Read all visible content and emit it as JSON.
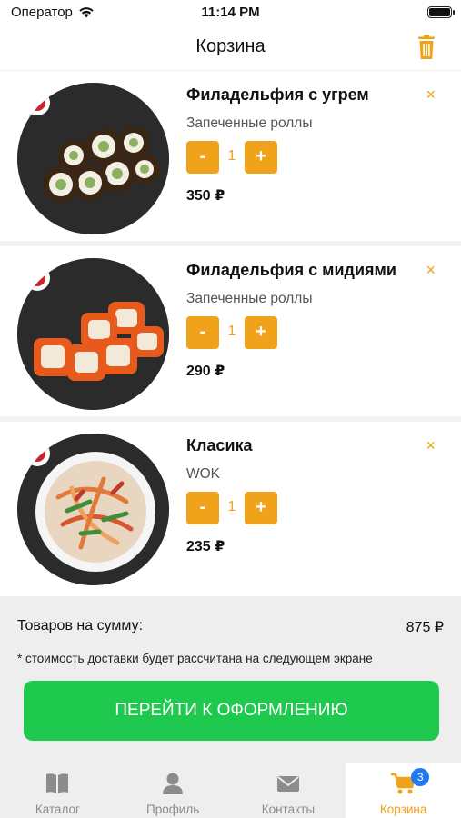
{
  "status_bar": {
    "carrier": "Оператор",
    "time": "11:14 PM"
  },
  "nav": {
    "title": "Корзина"
  },
  "cart": {
    "items": [
      {
        "name": "Филадельфия с угрем",
        "category": "Запеченные роллы",
        "quantity": "1",
        "price": "350 ₽",
        "minus": "-",
        "plus": "+",
        "remove": "×"
      },
      {
        "name": "Филадельфия с мидиями",
        "category": "Запеченные роллы",
        "quantity": "1",
        "price": "290 ₽",
        "minus": "-",
        "plus": "+",
        "remove": "×"
      },
      {
        "name": "Класика",
        "category": "WOK",
        "quantity": "1",
        "price": "235 ₽",
        "minus": "-",
        "plus": "+",
        "remove": "×"
      }
    ]
  },
  "summary": {
    "total_label": "Товаров на сумму:",
    "total_value": "875 ₽",
    "delivery_note": "* стоимость доставки будет рассчитана на следующем экране",
    "checkout_label": "ПЕРЕЙТИ К ОФОРМЛЕНИЮ"
  },
  "tab_bar": {
    "tabs": [
      {
        "label": "Каталог",
        "icon": "book-icon"
      },
      {
        "label": "Профиль",
        "icon": "person-icon"
      },
      {
        "label": "Контакты",
        "icon": "envelope-icon"
      },
      {
        "label": "Корзина",
        "icon": "cart-icon",
        "badge": "3"
      }
    ],
    "active": "Корзина"
  },
  "colors": {
    "accent": "#f0a21b",
    "checkout": "#1ec94d",
    "badge": "#1f7cf0"
  }
}
